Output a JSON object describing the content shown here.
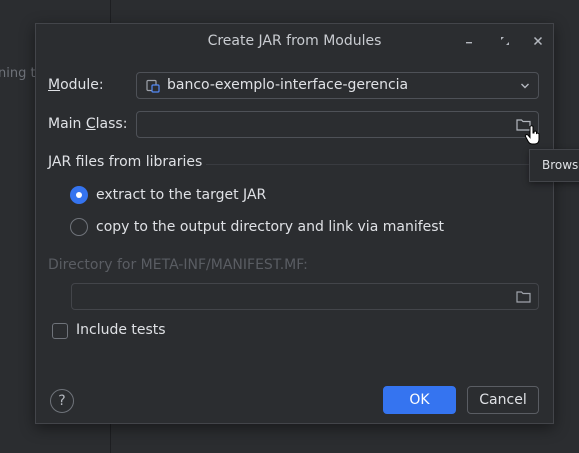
{
  "background": {
    "partial_text": "ning to"
  },
  "dialog": {
    "title": "Create JAR from Modules",
    "module_label_prefix": "M",
    "module_label_rest": "odule:",
    "module_value": "banco-exemplo-interface-gerencia",
    "main_class_label_prefix": "Main ",
    "main_class_label_mnemonic": "C",
    "main_class_label_rest": "lass:",
    "main_class_value": "",
    "jar_section_title": "JAR files from libraries",
    "radio_extract": "extract to the target JAR",
    "radio_copy": "copy to the output directory and link via manifest",
    "manifest_dir_label": "Directory for META-INF/MANIFEST.MF:",
    "manifest_dir_value": "",
    "include_tests_label": "Include tests",
    "ok_label": "OK",
    "cancel_label": "Cancel",
    "help_glyph": "?"
  },
  "tooltip": {
    "text": "Browse"
  },
  "icons": {
    "module": "module-icon",
    "dropdown": "chevron-down-icon",
    "browse": "folder-icon",
    "minimize": "minimize-icon",
    "maximize": "maximize-icon",
    "close": "close-icon"
  },
  "colors": {
    "accent": "#3574f0",
    "background": "#2b2d30",
    "text": "#dfe1e5",
    "disabled_text": "#5a5d63"
  }
}
